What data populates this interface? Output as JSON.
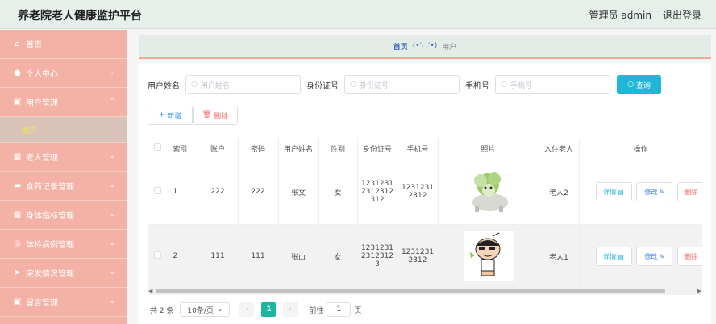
{
  "header": {
    "title": "养老院老人健康监护平台",
    "user": "管理员 admin",
    "logout": "退出登录"
  },
  "sidebar": {
    "items": [
      {
        "label": "首页",
        "icon": "home-icon",
        "expandable": false
      },
      {
        "label": "个人中心",
        "icon": "user-icon",
        "expandable": true
      },
      {
        "label": "用户管理",
        "icon": "clipboard-icon",
        "expandable": true,
        "expanded": true
      },
      {
        "label": "老人管理",
        "icon": "grid-icon",
        "expandable": true
      },
      {
        "label": "食药记录管理",
        "icon": "briefcase-icon",
        "expandable": true
      },
      {
        "label": "身体指标管理",
        "icon": "grid-icon",
        "expandable": true
      },
      {
        "label": "体检病例管理",
        "icon": "globe-icon",
        "expandable": true
      },
      {
        "label": "突发情况管理",
        "icon": "send-icon",
        "expandable": true
      },
      {
        "label": "留言管理",
        "icon": "clipboard-icon",
        "expandable": true
      }
    ],
    "submenu": {
      "label": "用户"
    }
  },
  "breadcrumb": {
    "home": "首页",
    "sep": "(•'◡'•)",
    "current": "用户"
  },
  "search": {
    "fields": [
      {
        "label": "用户姓名",
        "placeholder": "用户姓名"
      },
      {
        "label": "身份证号",
        "placeholder": "身份证号"
      },
      {
        "label": "手机号",
        "placeholder": "手机号"
      }
    ],
    "query_label": "查询"
  },
  "actions": {
    "add": "新增",
    "delete": "删除"
  },
  "table": {
    "headers": [
      "索引",
      "账户",
      "密码",
      "用户姓名",
      "性别",
      "身份证号",
      "手机号",
      "照片",
      "入住老人",
      "操作"
    ],
    "rows": [
      {
        "index": "1",
        "account": "222",
        "password": "222",
        "name": "张文",
        "gender": "女",
        "id_card": "123123123123123123 12",
        "id_lines": [
          "1231231",
          "2312312",
          "312"
        ],
        "phone_lines": [
          "1231231",
          "2312"
        ],
        "photo": "cabbage-dog-photo",
        "elder": "老人2"
      },
      {
        "index": "2",
        "account": "111",
        "password": "111",
        "name": "张山",
        "gender": "女",
        "id_lines": [
          "1231231",
          "2312312",
          "3"
        ],
        "phone_lines": [
          "1231231",
          "2312"
        ],
        "photo": "cartoon-boy-photo",
        "elder": "老人1"
      }
    ],
    "op_labels": {
      "detail": "详情",
      "edit": "修改",
      "delete": "删除"
    }
  },
  "pagination": {
    "total": "共 2 条",
    "page_size": "10条/页",
    "current_page": "1",
    "goto_label": "前往",
    "goto_value": "1",
    "page_suffix": "页"
  },
  "colors": {
    "sidebar_bg": "#f4b1a6",
    "submenu_text": "#f7e64a",
    "query_btn": "#1fb6d8",
    "page_active": "#1fb6a0",
    "breadcrumb_accent": "#3b67b5"
  }
}
